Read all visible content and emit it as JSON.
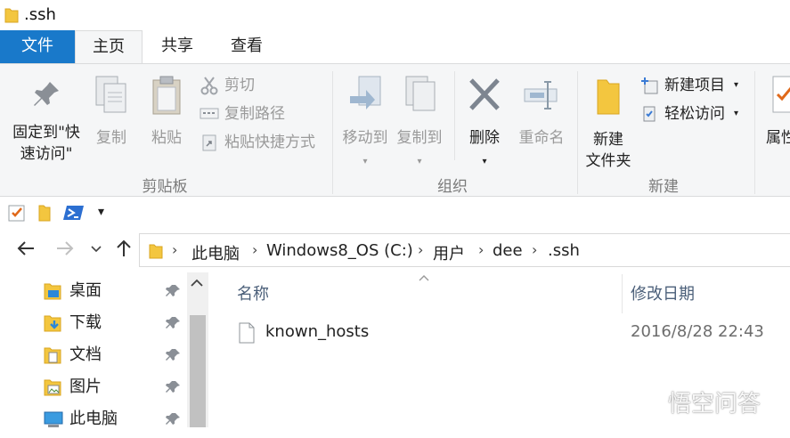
{
  "window": {
    "title": ".ssh"
  },
  "ribbon_tabs": {
    "file": "文件",
    "home": "主页",
    "share": "共享",
    "view": "查看"
  },
  "clipboard": {
    "pin_line1": "固定到\"快",
    "pin_line2": "速访问\"",
    "copy": "复制",
    "paste": "粘贴",
    "cut": "剪切",
    "copy_path": "复制路径",
    "paste_shortcut": "粘贴快捷方式",
    "group": "剪贴板"
  },
  "organize": {
    "move_to": "移动到",
    "copy_to": "复制到",
    "delete": "删除",
    "rename": "重命名",
    "group": "组织"
  },
  "new": {
    "new_folder_line1": "新建",
    "new_folder_line2": "文件夹",
    "new_item": "新建项目",
    "easy_access": "轻松访问",
    "group": "新建"
  },
  "open": {
    "properties_partial": "属性"
  },
  "breadcrumb": [
    "此电脑",
    "Windows8_OS (C:)",
    "用户",
    "dee",
    ".ssh"
  ],
  "nav_pane": [
    "桌面",
    "下载",
    "文档",
    "图片",
    "此电脑"
  ],
  "columns": {
    "name": "名称",
    "modified": "修改日期"
  },
  "files": [
    {
      "name": "known_hosts",
      "modified": "2016/8/28 22:43"
    }
  ],
  "watermark": {
    "text": "悟空问答"
  },
  "colors": {
    "accent": "#1979ca",
    "ribbon_bg": "#f5f6f7",
    "folder": "#f3c63f"
  }
}
